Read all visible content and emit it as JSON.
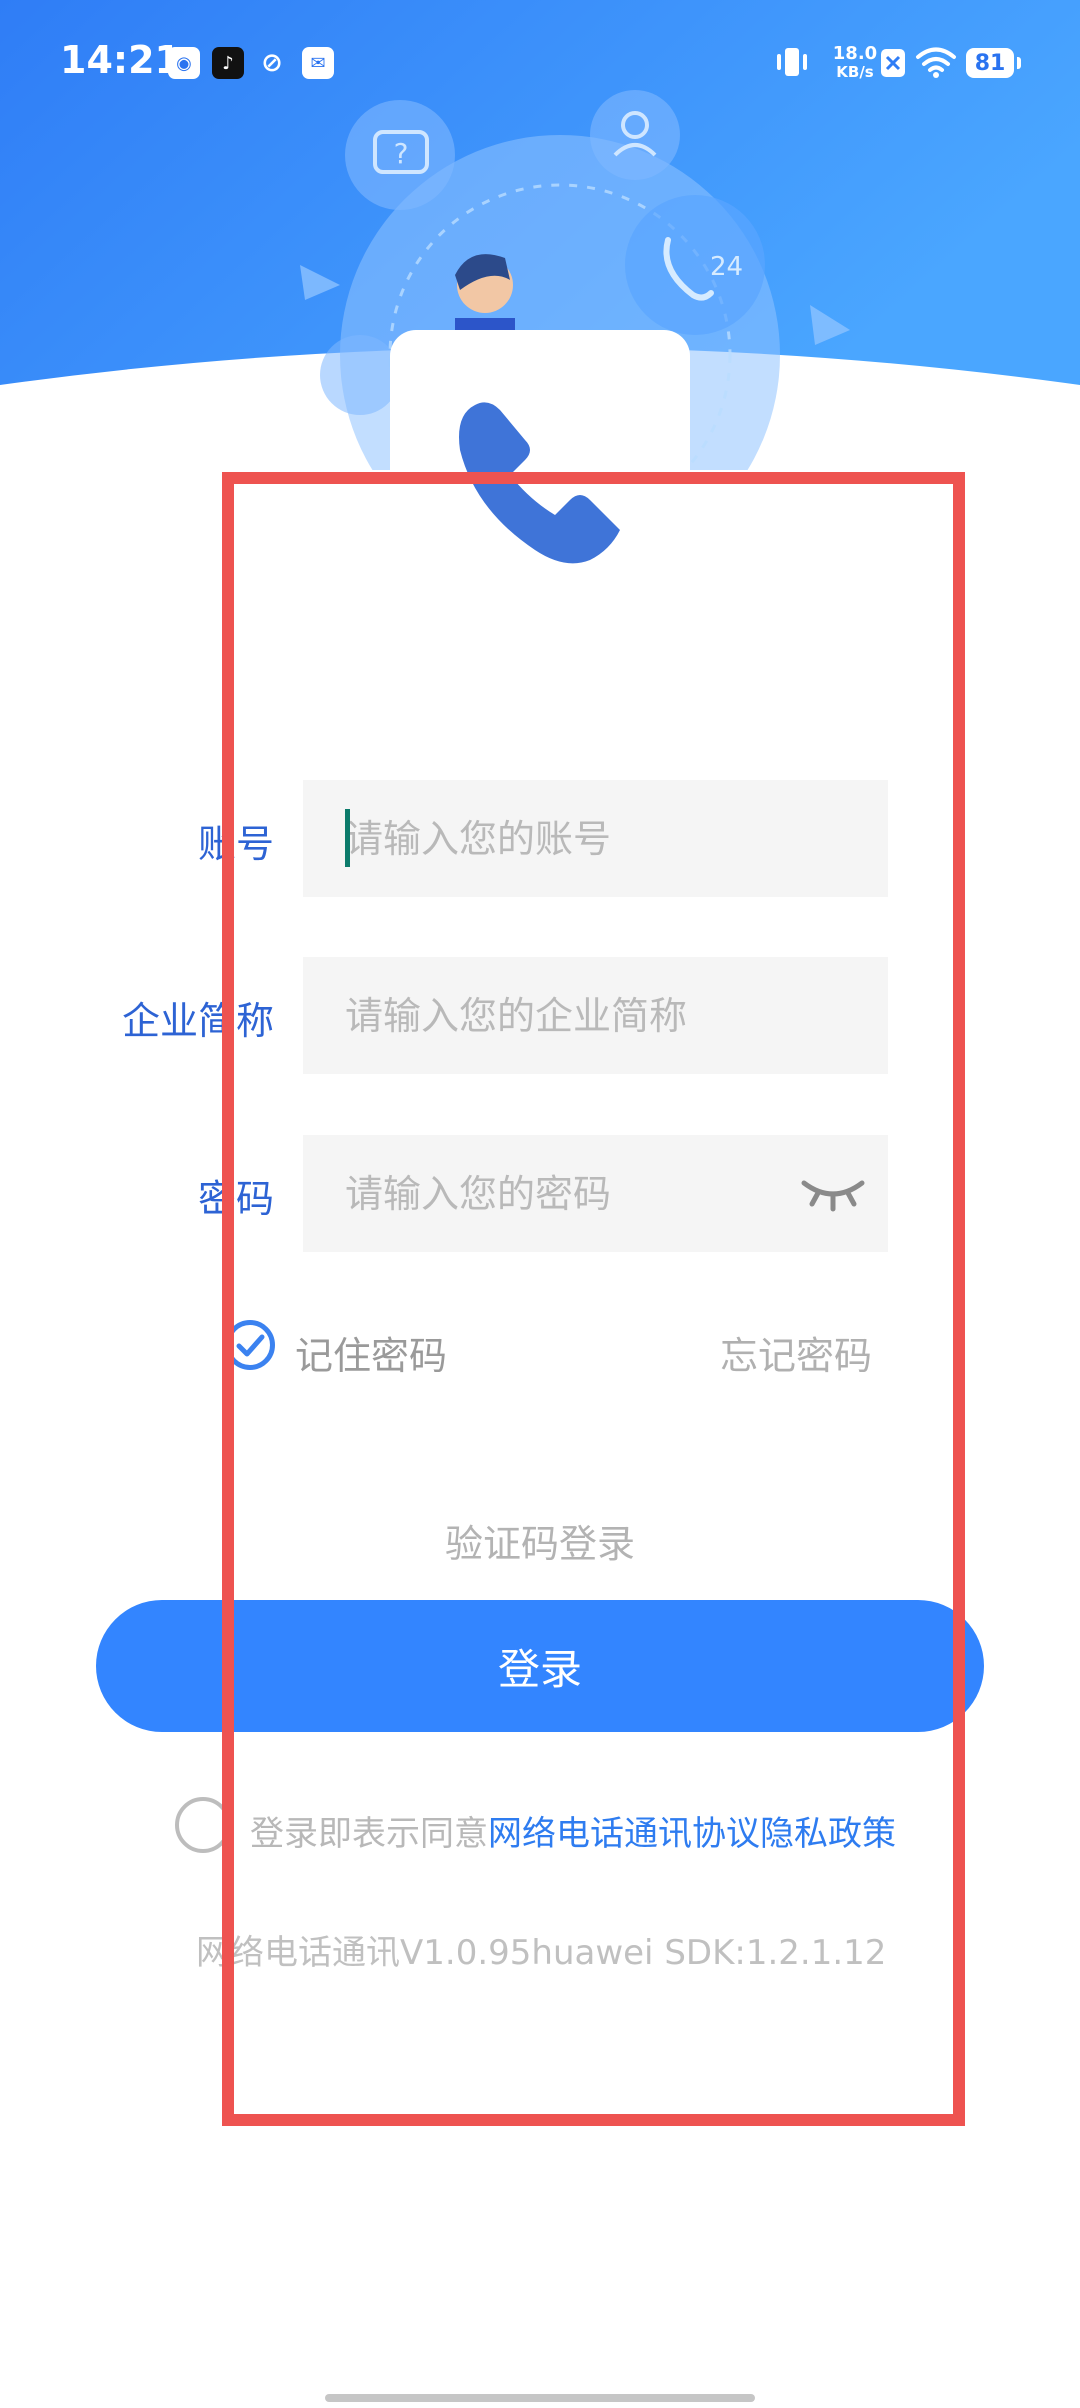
{
  "status_bar": {
    "time": "14:21",
    "net_speed_value": "18.0",
    "net_speed_unit": "KB/s",
    "battery": "81",
    "icons": [
      "baidu-app-icon",
      "tiktok-icon",
      "browser-icon",
      "mail-icon",
      "vibrate-icon",
      "sim-off-icon",
      "wifi-icon"
    ]
  },
  "header": {
    "illustration_badge": "24",
    "colors": {
      "gradient_start": "#2f7df6",
      "gradient_end": "#4aa6ff"
    }
  },
  "form": {
    "account": {
      "label": "账号",
      "placeholder": "请输入您的账号"
    },
    "company": {
      "label": "企业简称",
      "placeholder": "请输入您的企业简称"
    },
    "password": {
      "label": "密码",
      "placeholder": "请输入您的密码"
    },
    "remember_label": "记住密码",
    "remember_checked": true,
    "forgot_label": "忘记密码",
    "sms_login_label": "验证码登录",
    "login_button_label": "登录"
  },
  "agreement": {
    "checked": false,
    "prefix": "登录即表示同意",
    "link1": "网络电话通讯协议",
    "link2": "隐私政策"
  },
  "footer": {
    "version": "网络电话通讯V1.0.95huawei  SDK:1.2.1.12"
  },
  "colors": {
    "accent": "#3385ff",
    "label": "#2d63d4",
    "annotation": "#ee5350"
  }
}
